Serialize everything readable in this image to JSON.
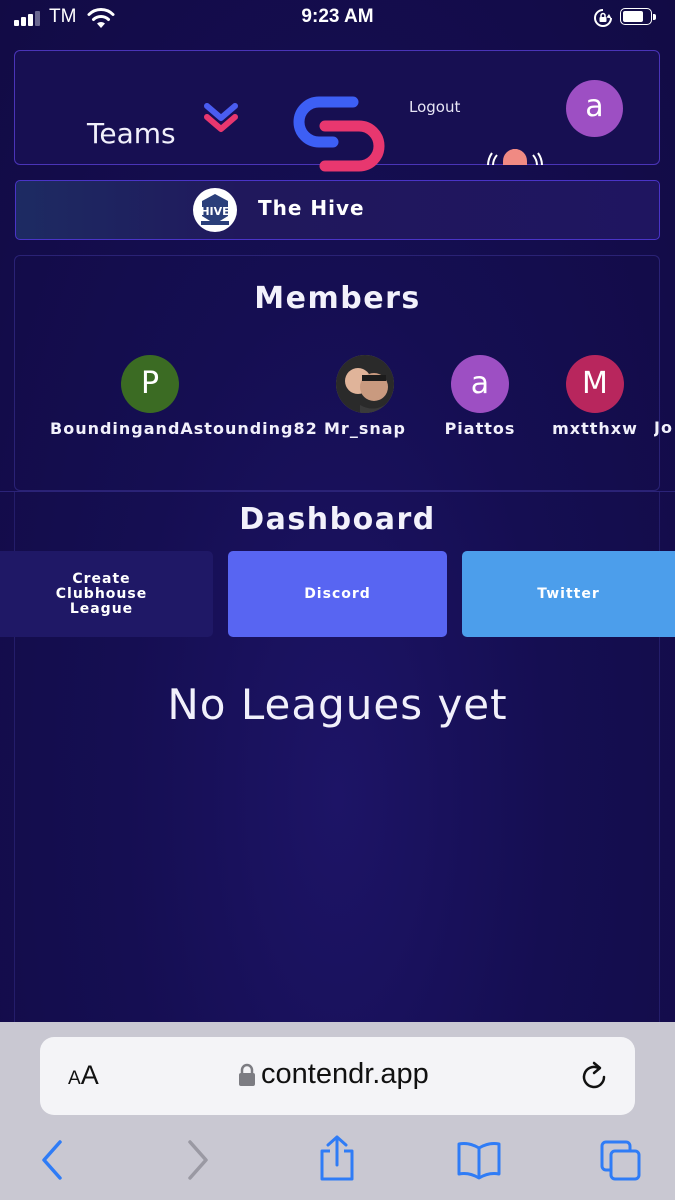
{
  "status_bar": {
    "carrier": "TM",
    "time": "9:23 AM"
  },
  "header": {
    "teams_label": "Teams",
    "logout_label": "Logout",
    "avatar_letter": "a"
  },
  "team": {
    "name": "The Hive",
    "logo_text": "HIVE"
  },
  "members": {
    "title": "Members",
    "items": [
      {
        "initial": "P",
        "name": "BoundingandAstounding82",
        "color": "#3b6b23"
      },
      {
        "initial": "",
        "name": "Mr_snap",
        "color": "#8a7d6e"
      },
      {
        "initial": "a",
        "name": "Piattos",
        "color": "#9d4fc3"
      },
      {
        "initial": "M",
        "name": "mxtthxw",
        "color": "#b8265d"
      },
      {
        "initial": "",
        "name": "Jo",
        "color": "#130c48"
      }
    ]
  },
  "dashboard": {
    "title": "Dashboard",
    "buttons": [
      {
        "label": "Create Clubhouse League",
        "color": "#1f1866"
      },
      {
        "label": "Discord",
        "color": "#5865f2"
      },
      {
        "label": "Twitter",
        "color": "#4c9eeb"
      }
    ],
    "empty_message": "No Leagues yet"
  },
  "browser": {
    "aa_small": "A",
    "aa_big": "A",
    "url": "contendr.app"
  },
  "colors": {
    "accent_blue": "#3d5ff5",
    "accent_pink": "#e8376f",
    "link_blue": "#2f7cf6"
  }
}
